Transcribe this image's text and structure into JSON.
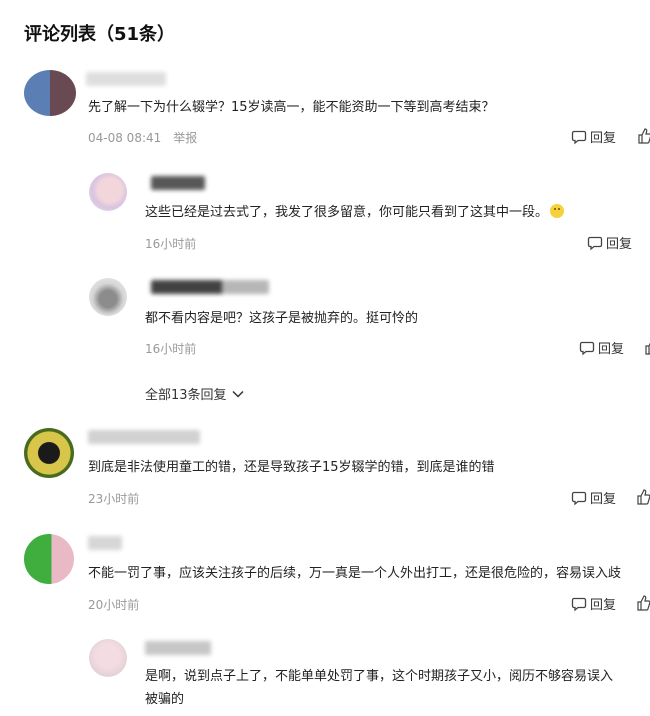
{
  "title": "评论列表（51条）",
  "reply_label": "回复",
  "expand_replies": "全部13条回复",
  "comments": [
    {
      "text": "先了解一下为什么辍学？15岁读高一，能不能资助一下等到高考结束？",
      "time": "04-08 08:41",
      "report": "举报"
    },
    {
      "text": "这些已经是过去式了，我发了很多留意，你可能只看到了这其中一段。",
      "time": "16小时前"
    },
    {
      "text": "都不看内容是吧？这孩子是被抛弃的。挺可怜的",
      "time": "16小时前"
    },
    {
      "text": "到底是非法使用童工的错，还是导致孩子15岁辍学的错，到底是谁的错",
      "time": "23小时前"
    },
    {
      "text": "不能一罚了事，应该关注孩子的后续，万一真是一个人外出打工，还是很危险的，容易误入歧",
      "time": "20小时前"
    },
    {
      "text": "是啊，说到点子上了，不能单单处罚了事，这个时期孩子又小，阅历不够容易误入",
      "text2": "被骗的"
    }
  ]
}
